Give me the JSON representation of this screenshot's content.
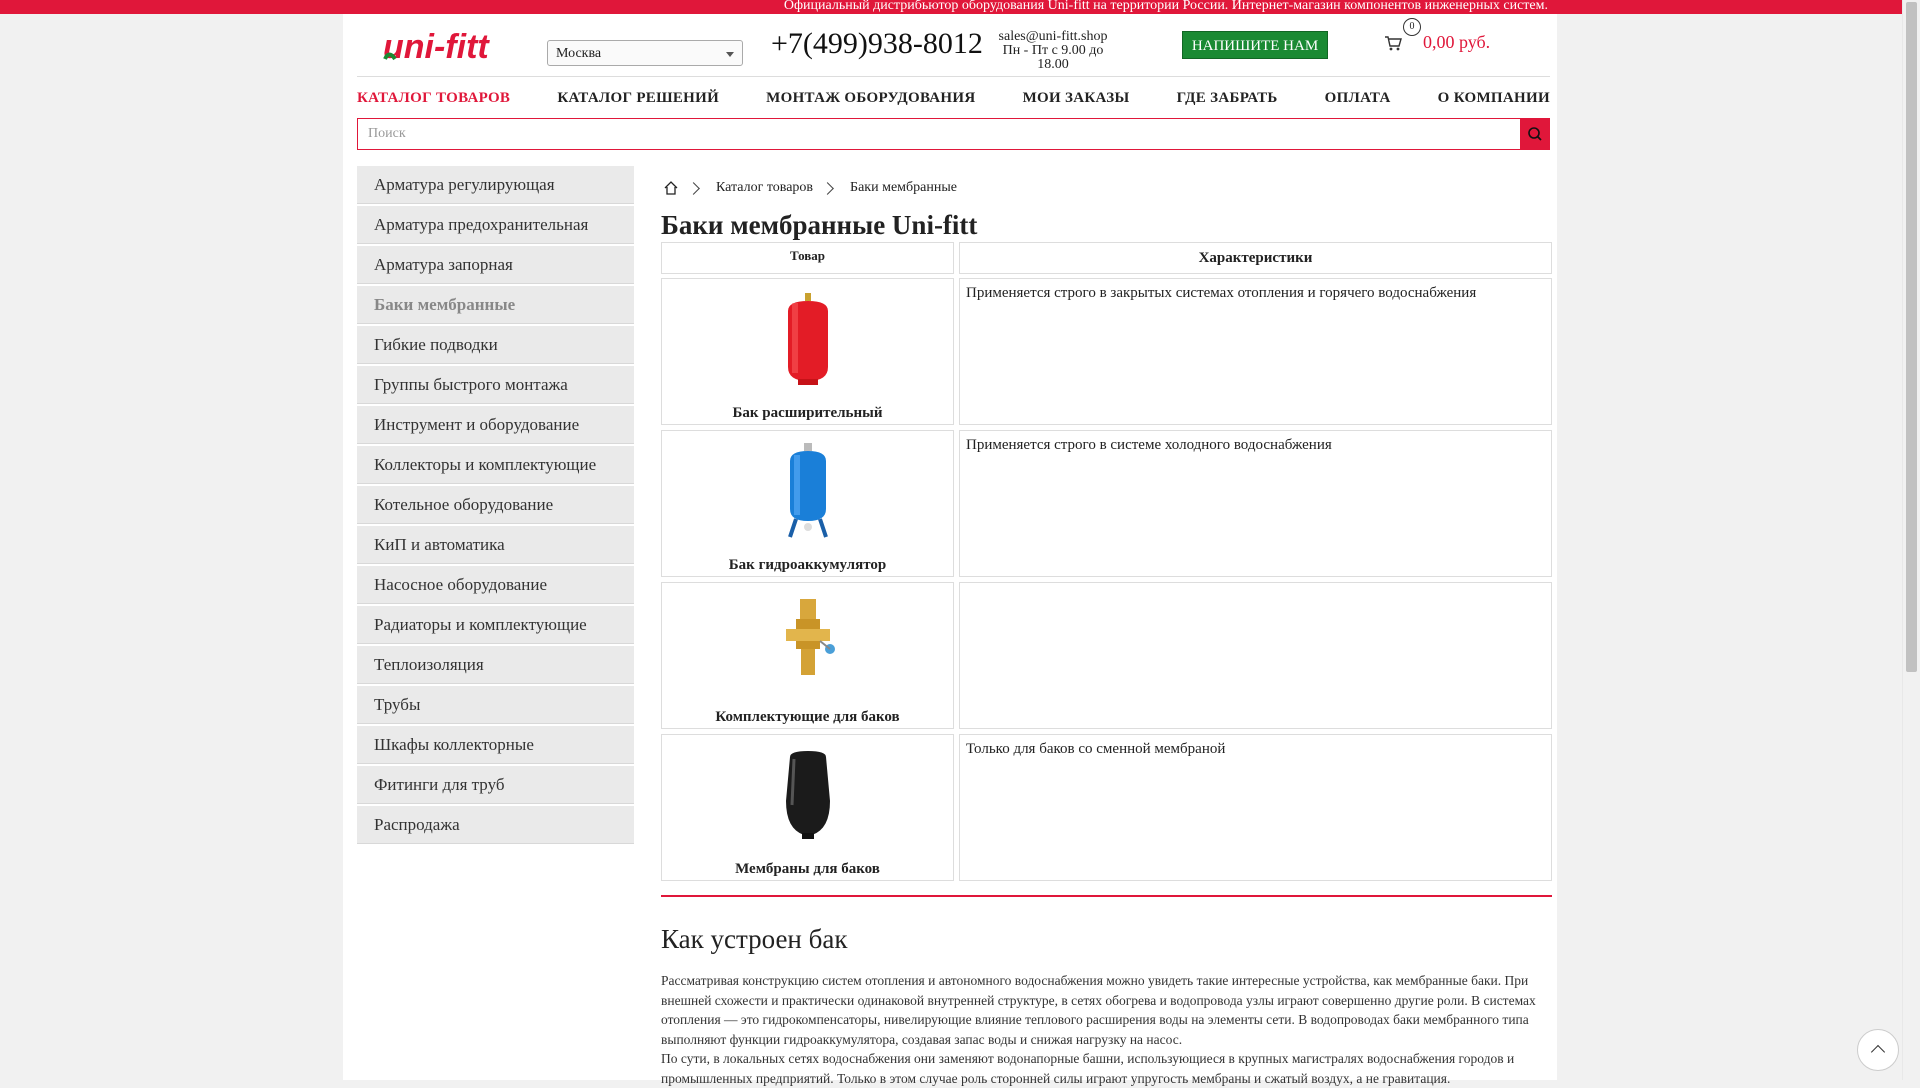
{
  "topbar": {
    "text": "Официальный дистрибьютор оборудования Uni-fitt на территории России. Интернет-магазин компонентов инженерных систем."
  },
  "header": {
    "logo_text": "uni-fitt",
    "city": "Москва",
    "phone": "+7(499)938-8012",
    "email": "sales@uni-fitt.shop",
    "hours": "Пн - Пт с 9.00 до 18.00",
    "write_button": "НАПИШИТЕ НАМ",
    "cart_count": "0",
    "cart_total": "0,00 руб."
  },
  "nav": [
    "КАТАЛОГ ТОВАРОВ",
    "КАТАЛОГ РЕШЕНИЙ",
    "МОНТАЖ ОБОРУДОВАНИЯ",
    "МОИ ЗАКАЗЫ",
    "ГДЕ ЗАБРАТЬ",
    "ОПЛАТА",
    "О КОМПАНИИ"
  ],
  "search": {
    "placeholder": "Поиск"
  },
  "sidebar": [
    "Арматура регулирующая",
    "Арматура предохранительная",
    "Арматура запорная",
    "Баки мембранные",
    "Гибкие подводки",
    "Группы быстрого монтажа",
    "Инструмент и оборудование",
    "Коллекторы и комплектующие",
    "Котельное оборудование",
    "КиП и автоматика",
    "Насосное оборудование",
    "Радиаторы и комплектующие",
    "Теплоизоляция",
    "Трубы",
    "Шкафы коллекторные",
    "Фитинги для труб",
    "Распродажа"
  ],
  "sidebar_active": "Баки мембранные",
  "breadcrumb": [
    "Каталог товаров",
    "Баки мембранные"
  ],
  "title": "Баки мембранные Uni-fitt",
  "table": {
    "col_product": "Товар",
    "col_specs": "Характеристики",
    "rows": [
      {
        "name": "Бак расширительный",
        "desc": "Применяется строго в закрытых системах отопления и горячего водоснабжения",
        "image": "red-tank-icon"
      },
      {
        "name": "Бак гидроаккумулятор",
        "desc": "Применяется строго в системе холодного водоснабжения",
        "image": "blue-tank-icon"
      },
      {
        "name": "Комплектующие для баков",
        "desc": "",
        "image": "brass-fitting-icon"
      },
      {
        "name": "Мембраны для баков",
        "desc": "Только для баков со сменной мембраной",
        "image": "membrane-icon"
      }
    ]
  },
  "article": {
    "heading": "Как устроен бак",
    "p1": "Рассматривая конструкцию систем отопления и автономного водоснабжения можно увидеть такие интересные устройства, как мембранные баки. При внешней схожести и практически одинаковой внутренней структуре, в сетях обогрева и водопровода узлы играют совершенно другие роли. В системах отопления — это гидрокомпенсаторы, нивелирующие влияние теплового расширения воды на элементы сети. В водопроводах баки мембранного типа выполняют функции гидроаккумулятора, создавая запас воды и снижая нагрузку на насос.",
    "p2": "По сути, в локальных сетях водоснабжения они заменяют водонапорные башни, использующиеся в крупных магистралях водоснабжения городов и промышленных предприятий. Только в этом случае роль сторонней силы играют упругость мембраны и сжатый воздух, а не гравитация."
  },
  "colors": {
    "accent": "#e0173a",
    "button_green": "#1a8a33"
  }
}
